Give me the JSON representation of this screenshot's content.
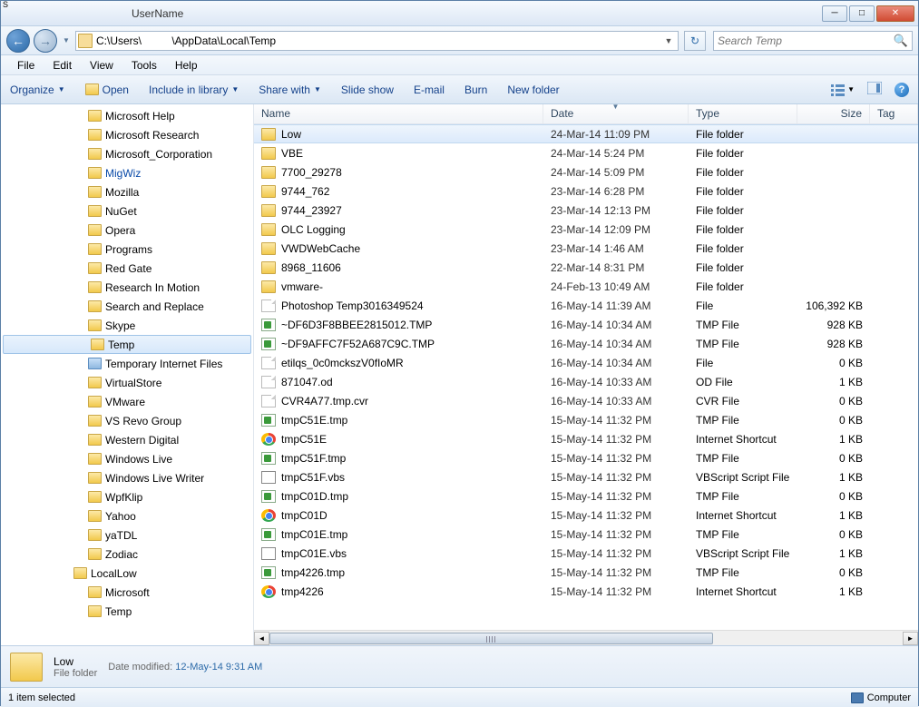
{
  "titlebar": {
    "text": "UserName"
  },
  "nav": {
    "path": "C:\\Users\\          \\AppData\\Local\\Temp",
    "search_placeholder": "Search Temp"
  },
  "menu": [
    "File",
    "Edit",
    "View",
    "Tools",
    "Help"
  ],
  "toolbar": {
    "organize": "Organize",
    "open": "Open",
    "include": "Include in library",
    "share": "Share with",
    "slide": "Slide show",
    "email": "E-mail",
    "burn": "Burn",
    "newfolder": "New folder"
  },
  "tree": [
    {
      "label": "Microsoft Help"
    },
    {
      "label": "Microsoft Research"
    },
    {
      "label": "Microsoft_Corporation"
    },
    {
      "label": "MigWiz",
      "cls": "highlight"
    },
    {
      "label": "Mozilla"
    },
    {
      "label": "NuGet"
    },
    {
      "label": "Opera"
    },
    {
      "label": "Programs"
    },
    {
      "label": "Red Gate"
    },
    {
      "label": "Research In Motion"
    },
    {
      "label": "Search and Replace"
    },
    {
      "label": "Skype"
    },
    {
      "label": "Temp",
      "sel": true
    },
    {
      "label": "Temporary Internet Files",
      "sp": true
    },
    {
      "label": "VirtualStore"
    },
    {
      "label": "VMware"
    },
    {
      "label": "VS Revo Group"
    },
    {
      "label": "Western Digital"
    },
    {
      "label": "Windows Live"
    },
    {
      "label": "Windows Live Writer"
    },
    {
      "label": "WpfKlip"
    },
    {
      "label": "Yahoo"
    },
    {
      "label": "yaTDL"
    },
    {
      "label": "Zodiac"
    },
    {
      "label": "LocalLow",
      "d": 1
    },
    {
      "label": "Microsoft"
    },
    {
      "label": "Temp"
    }
  ],
  "columns": {
    "name": "Name",
    "date": "Date",
    "type": "Type",
    "size": "Size",
    "tag": "Tag"
  },
  "rows": [
    {
      "ic": "folder",
      "name": "Low",
      "date": "24-Mar-14 11:09 PM",
      "type": "File folder",
      "size": "",
      "sel": true
    },
    {
      "ic": "folder",
      "name": "VBE",
      "date": "24-Mar-14 5:24 PM",
      "type": "File folder",
      "size": ""
    },
    {
      "ic": "folder",
      "name": "7700_29278",
      "date": "24-Mar-14 5:09 PM",
      "type": "File folder",
      "size": ""
    },
    {
      "ic": "folder",
      "name": "9744_762",
      "date": "23-Mar-14 6:28 PM",
      "type": "File folder",
      "size": ""
    },
    {
      "ic": "folder",
      "name": "9744_23927",
      "date": "23-Mar-14 12:13 PM",
      "type": "File folder",
      "size": ""
    },
    {
      "ic": "folder",
      "name": "OLC Logging",
      "date": "23-Mar-14 12:09 PM",
      "type": "File folder",
      "size": ""
    },
    {
      "ic": "folder",
      "name": "VWDWebCache",
      "date": "23-Mar-14 1:46 AM",
      "type": "File folder",
      "size": ""
    },
    {
      "ic": "folder",
      "name": "8968_11606",
      "date": "22-Mar-14 8:31 PM",
      "type": "File folder",
      "size": ""
    },
    {
      "ic": "folder",
      "name": "vmware-",
      "date": "24-Feb-13 10:49 AM",
      "type": "File folder",
      "size": ""
    },
    {
      "ic": "file",
      "name": "Photoshop Temp3016349524",
      "date": "16-May-14 11:39 AM",
      "type": "File",
      "size": "106,392 KB"
    },
    {
      "ic": "tmp",
      "name": "~DF6D3F8BBEE2815012.TMP",
      "date": "16-May-14 10:34 AM",
      "type": "TMP File",
      "size": "928 KB"
    },
    {
      "ic": "tmp",
      "name": "~DF9AFFC7F52A687C9C.TMP",
      "date": "16-May-14 10:34 AM",
      "type": "TMP File",
      "size": "928 KB"
    },
    {
      "ic": "file",
      "name": "etilqs_0c0mckszV0fIoMR",
      "date": "16-May-14 10:34 AM",
      "type": "File",
      "size": "0 KB"
    },
    {
      "ic": "file",
      "name": "871047.od",
      "date": "16-May-14 10:33 AM",
      "type": "OD File",
      "size": "1 KB"
    },
    {
      "ic": "file",
      "name": "CVR4A77.tmp.cvr",
      "date": "16-May-14 10:33 AM",
      "type": "CVR File",
      "size": "0 KB"
    },
    {
      "ic": "tmp",
      "name": "tmpC51E.tmp",
      "date": "15-May-14 11:32 PM",
      "type": "TMP File",
      "size": "0 KB"
    },
    {
      "ic": "chrome",
      "name": "tmpC51E",
      "date": "15-May-14 11:32 PM",
      "type": "Internet Shortcut",
      "size": "1 KB"
    },
    {
      "ic": "tmp",
      "name": "tmpC51F.tmp",
      "date": "15-May-14 11:32 PM",
      "type": "TMP File",
      "size": "0 KB"
    },
    {
      "ic": "vbs",
      "name": "tmpC51F.vbs",
      "date": "15-May-14 11:32 PM",
      "type": "VBScript Script File",
      "size": "1 KB"
    },
    {
      "ic": "tmp",
      "name": "tmpC01D.tmp",
      "date": "15-May-14 11:32 PM",
      "type": "TMP File",
      "size": "0 KB"
    },
    {
      "ic": "chrome",
      "name": "tmpC01D",
      "date": "15-May-14 11:32 PM",
      "type": "Internet Shortcut",
      "size": "1 KB"
    },
    {
      "ic": "tmp",
      "name": "tmpC01E.tmp",
      "date": "15-May-14 11:32 PM",
      "type": "TMP File",
      "size": "0 KB"
    },
    {
      "ic": "vbs",
      "name": "tmpC01E.vbs",
      "date": "15-May-14 11:32 PM",
      "type": "VBScript Script File",
      "size": "1 KB"
    },
    {
      "ic": "tmp",
      "name": "tmp4226.tmp",
      "date": "15-May-14 11:32 PM",
      "type": "TMP File",
      "size": "0 KB"
    },
    {
      "ic": "chrome",
      "name": "tmp4226",
      "date": "15-May-14 11:32 PM",
      "type": "Internet Shortcut",
      "size": "1 KB"
    }
  ],
  "details": {
    "name": "Low",
    "type": "File folder",
    "modlabel": "Date modified:",
    "modval": "12-May-14 9:31 AM"
  },
  "status": {
    "left": "1 item selected",
    "right": "Computer"
  }
}
